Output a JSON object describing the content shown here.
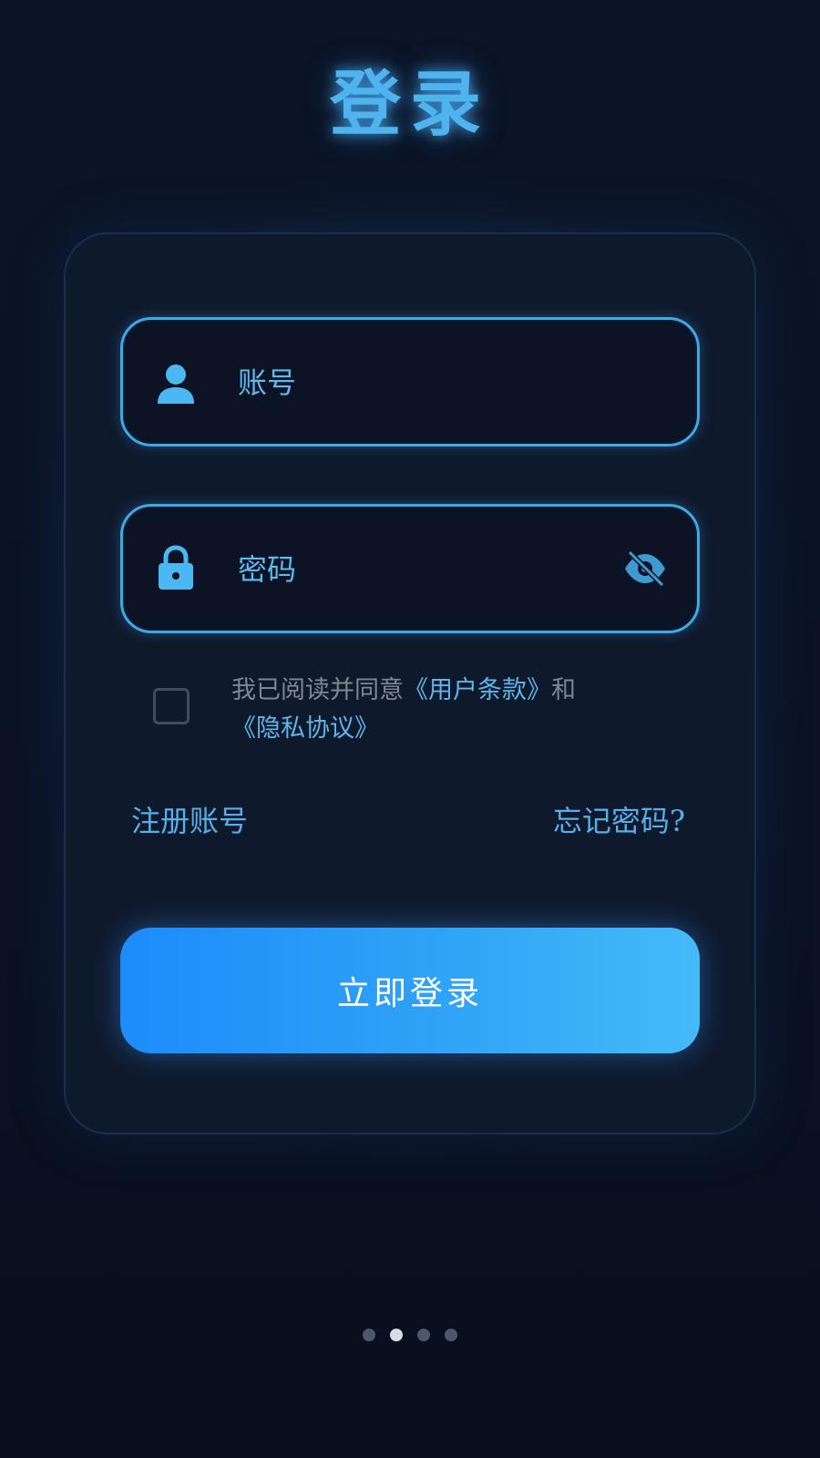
{
  "title": "登录",
  "form": {
    "account_placeholder": "账号",
    "password_placeholder": "密码"
  },
  "agreement": {
    "prefix": "我已阅读并同意",
    "terms_link": "《用户条款》",
    "connector": "和",
    "privacy_link": "《隐私协议》",
    "checked": false
  },
  "links": {
    "register": "注册账号",
    "forgot": "忘记密码?"
  },
  "login_button": "立即登录",
  "pager": {
    "total": 4,
    "active_index": 1
  },
  "colors": {
    "accent": "#3fa8e6",
    "button_start": "#1d8bfb",
    "button_end": "#45baf8",
    "background": "#0a1122"
  },
  "icons": {
    "account": "user-icon",
    "password": "lock-icon",
    "toggle": "eye-off-icon"
  }
}
